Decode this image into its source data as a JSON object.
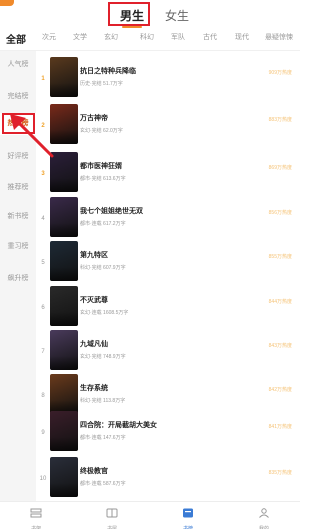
{
  "gender_tabs": {
    "male": "男生",
    "female": "女生",
    "active": "male"
  },
  "categories": [
    "全部",
    "次元",
    "文学",
    "玄幻",
    "科幻",
    "军队",
    "古代",
    "现代",
    "悬疑惊悚"
  ],
  "rank_lists": [
    "人气榜",
    "完结榜",
    "热搜榜",
    "好评榜",
    "推荐榜",
    "新书榜",
    "重习榜",
    "飙升榜"
  ],
  "active_rank": "热搜榜",
  "books": [
    {
      "rank": "1",
      "title": "抗日之特种兵降临",
      "meta": "历史·完结 51.7万字",
      "popularity": "909万热度"
    },
    {
      "rank": "2",
      "title": "万古神帝",
      "meta": "玄幻·完结 62.0万字",
      "popularity": "883万热度"
    },
    {
      "rank": "3",
      "title": "都市医神狂婿",
      "meta": "都市·完结 613.6万字",
      "popularity": "869万热度"
    },
    {
      "rank": "4",
      "title": "我七个姐姐绝世无双",
      "meta": "都市·连载 617.2万字",
      "popularity": "856万热度"
    },
    {
      "rank": "5",
      "title": "第九特区",
      "meta": "科幻·完结 607.9万字",
      "popularity": "855万热度"
    },
    {
      "rank": "6",
      "title": "不灭武尊",
      "meta": "玄幻·连载 1608.5万字",
      "popularity": "844万热度"
    },
    {
      "rank": "7",
      "title": "九域凡仙",
      "meta": "玄幻·完结 748.9万字",
      "popularity": "843万热度"
    },
    {
      "rank": "8",
      "title": "生存系统",
      "meta": "科幻·完结 113.8万字",
      "popularity": "842万热度"
    },
    {
      "rank": "9",
      "title": "四合院：开局截胡大美女",
      "meta": "都市·连载 147.6万字",
      "popularity": "841万热度"
    },
    {
      "rank": "10",
      "title": "终极教官",
      "meta": "都市·连载 587.6万字",
      "popularity": "835万热度"
    }
  ],
  "cover_colors": [
    "#5a3a1e",
    "#7a2a1a",
    "#2b1f3a",
    "#3a2a4a",
    "#1e2a36",
    "#2a2a2a",
    "#4a3b5c",
    "#6b3b1c",
    "#3a1e2a",
    "#2a2e3a"
  ],
  "bottom_nav": [
    {
      "label": "书架",
      "icon": "bookshelf-icon"
    },
    {
      "label": "书屋",
      "icon": "bookstore-icon"
    },
    {
      "label": "书榜",
      "icon": "ranking-icon",
      "active": true
    },
    {
      "label": "我的",
      "icon": "profile-icon"
    }
  ],
  "colors": {
    "accent": "#f08a2b",
    "annotation": "#e0202b",
    "active_nav": "#3a7bd5",
    "active_rank": "#d45b14"
  }
}
